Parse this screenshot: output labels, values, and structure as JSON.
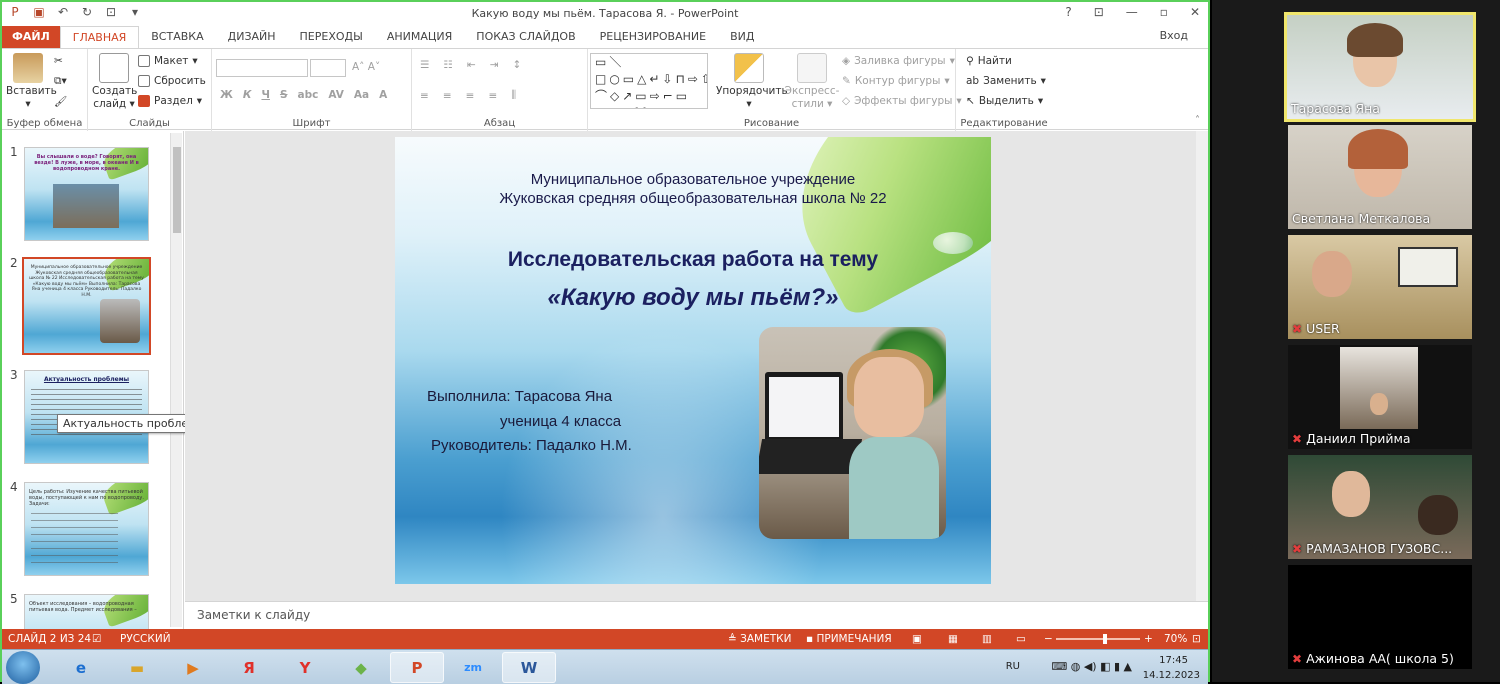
{
  "window": {
    "title": "Какую воду мы пьём. Тарасова Я. - PowerPoint",
    "help": "?",
    "signin": "Вход"
  },
  "tabs": [
    "ФАЙЛ",
    "ГЛАВНАЯ",
    "ВСТАВКА",
    "ДИЗАЙН",
    "ПЕРЕХОДЫ",
    "АНИМАЦИЯ",
    "ПОКАЗ СЛАЙДОВ",
    "РЕЦЕНЗИРОВАНИЕ",
    "ВИД"
  ],
  "ribbon": {
    "clipboard": {
      "paste": "Вставить",
      "label": "Буфер обмена"
    },
    "slides": {
      "new_slide_1": "Создать",
      "new_slide_2": "слайд",
      "layout": "Макет",
      "reset": "Сбросить",
      "section": "Раздел",
      "label": "Слайды"
    },
    "font": {
      "label": "Шрифт",
      "bold": "Ж",
      "italic": "К",
      "underline": "Ч",
      "strike": "S"
    },
    "paragraph": {
      "label": "Абзац"
    },
    "drawing": {
      "arrange": "Упорядочить",
      "styles_1": "Экспресс-",
      "styles_2": "стили",
      "fill": "Заливка фигуры",
      "outline": "Контур фигуры",
      "effects": "Эффекты фигуры",
      "label": "Рисование"
    },
    "editing": {
      "find": "Найти",
      "replace": "Заменить",
      "select": "Выделить",
      "label": "Редактирование"
    }
  },
  "thumbnails": [
    {
      "num": "1",
      "text": "Вы слышали о воде? Говорят, она везде! В луже, в море, в океане И в водопроводном кране."
    },
    {
      "num": "2",
      "text": "Муниципальное образовательное учреждение Жуковская средняя общеобразовательная школа № 22 Исследовательская работа на тему «Какую воду мы пьём» Выполнила: Тарасова Яна ученица 4 класса Руководитель: Падалко Н.М."
    },
    {
      "num": "3",
      "text": "Актуальность проблемы"
    },
    {
      "num": "4",
      "text": "Цель работы: Изучение качества питьевой воды, поступающей к нам по водопроводу. Задачи:"
    },
    {
      "num": "5",
      "text": "Объект исследования – водопроводная питьевая вода. Предмет исследования –"
    }
  ],
  "tooltip": "Актуальность проблемы",
  "slide": {
    "org_line1": "Муниципальное образовательное учреждение",
    "org_line2": "Жуковская средняя общеобразовательная школа № 22",
    "topic": "Исследовательская работа на тему",
    "title": "«Какую воду мы пьём?»",
    "author": "Выполнила: Тарасова Яна",
    "grade": "ученица 4 класса",
    "advisor": "Руководитель: Падалко Н.М."
  },
  "notes_placeholder": "Заметки к слайду",
  "statusbar": {
    "slide_counter": "СЛАЙД 2 ИЗ 24",
    "language": "РУССКИЙ",
    "notes": "ЗАМЕТКИ",
    "comments": "ПРИМЕЧАНИЯ",
    "zoom": "70%",
    "zoom_fraction": 0.58
  },
  "taskbar": {
    "lang": "RU",
    "time": "17:45",
    "date": "14.12.2023",
    "apps": [
      "windows-start",
      "internet-explorer",
      "file-explorer",
      "media-player",
      "yandex-search",
      "yandex-browser",
      "folder-app",
      "powerpoint",
      "zoom",
      "word"
    ]
  },
  "participants": [
    {
      "name": "Тарасова Яна",
      "muted": false,
      "speaking": true
    },
    {
      "name": "Светлана Меткалова",
      "muted": false,
      "speaking": false
    },
    {
      "name": "USER",
      "muted": true,
      "speaking": false
    },
    {
      "name": "Даниил Прийма",
      "muted": true,
      "speaking": false
    },
    {
      "name": "РАМАЗАНОВ ГУЗОВС...",
      "muted": true,
      "speaking": false
    },
    {
      "name": "Ажинова АА( школа 5)",
      "muted": true,
      "speaking": false
    }
  ],
  "colors": {
    "accent": "#d24726",
    "zoom_green": "#5ad05a",
    "speaking": "#f0e66c",
    "muted": "#e23d3d"
  }
}
